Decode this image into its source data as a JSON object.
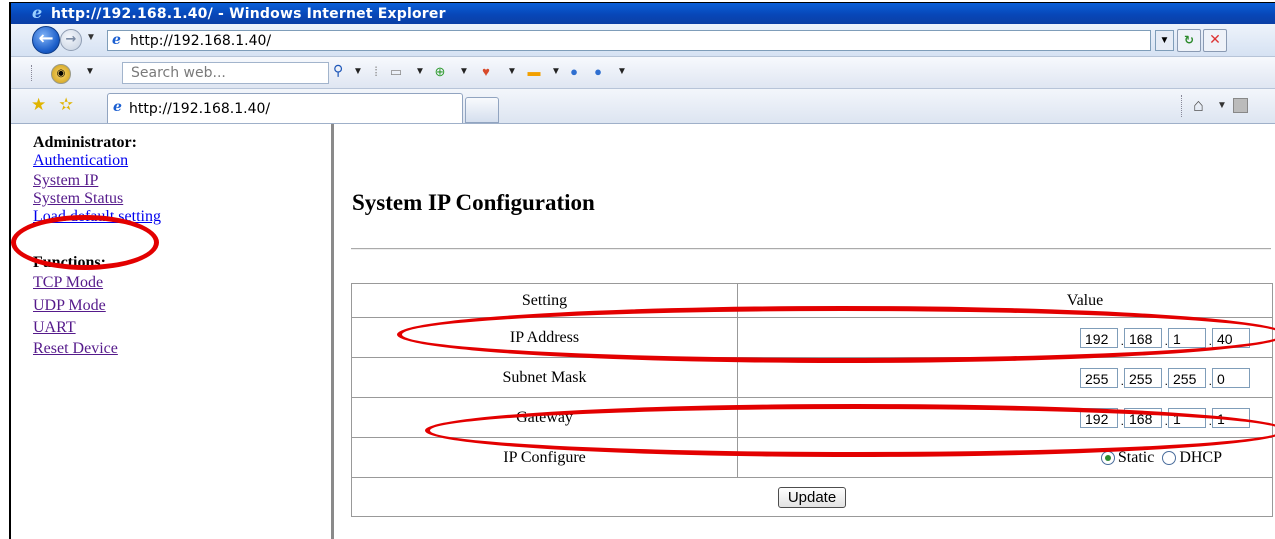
{
  "window": {
    "title": "http://192.168.1.40/ - Windows Internet Explorer",
    "address": "http://192.168.1.40/"
  },
  "search": {
    "placeholder": "Search web..."
  },
  "tabs": [
    {
      "label": "http://192.168.1.40/"
    }
  ],
  "sidebar": {
    "admin_heading": "Administrator:",
    "admin_items": [
      {
        "label": "Authentication"
      },
      {
        "label": "System IP"
      },
      {
        "label": "System Status"
      },
      {
        "label": "Load default setting"
      }
    ],
    "functions_heading": "Functions:",
    "function_items": [
      {
        "label": "TCP Mode"
      },
      {
        "label": "UDP Mode"
      },
      {
        "label": "UART"
      },
      {
        "label": "Reset Device"
      }
    ]
  },
  "main": {
    "title": "System IP Configuration",
    "table": {
      "headers": [
        "Setting",
        "Value"
      ],
      "rows": [
        {
          "setting": "IP Address",
          "octets": [
            "192",
            "168",
            "1",
            "40"
          ]
        },
        {
          "setting": "Subnet Mask",
          "octets": [
            "255",
            "255",
            "255",
            "0"
          ]
        },
        {
          "setting": "Gateway",
          "octets": [
            "192",
            "168",
            "1",
            "1"
          ]
        }
      ],
      "ip_configure": {
        "label": "IP Configure",
        "options": [
          "Static",
          "DHCP"
        ],
        "selected": "Static"
      },
      "update_label": "Update"
    }
  },
  "annotation_color": "#e30000"
}
